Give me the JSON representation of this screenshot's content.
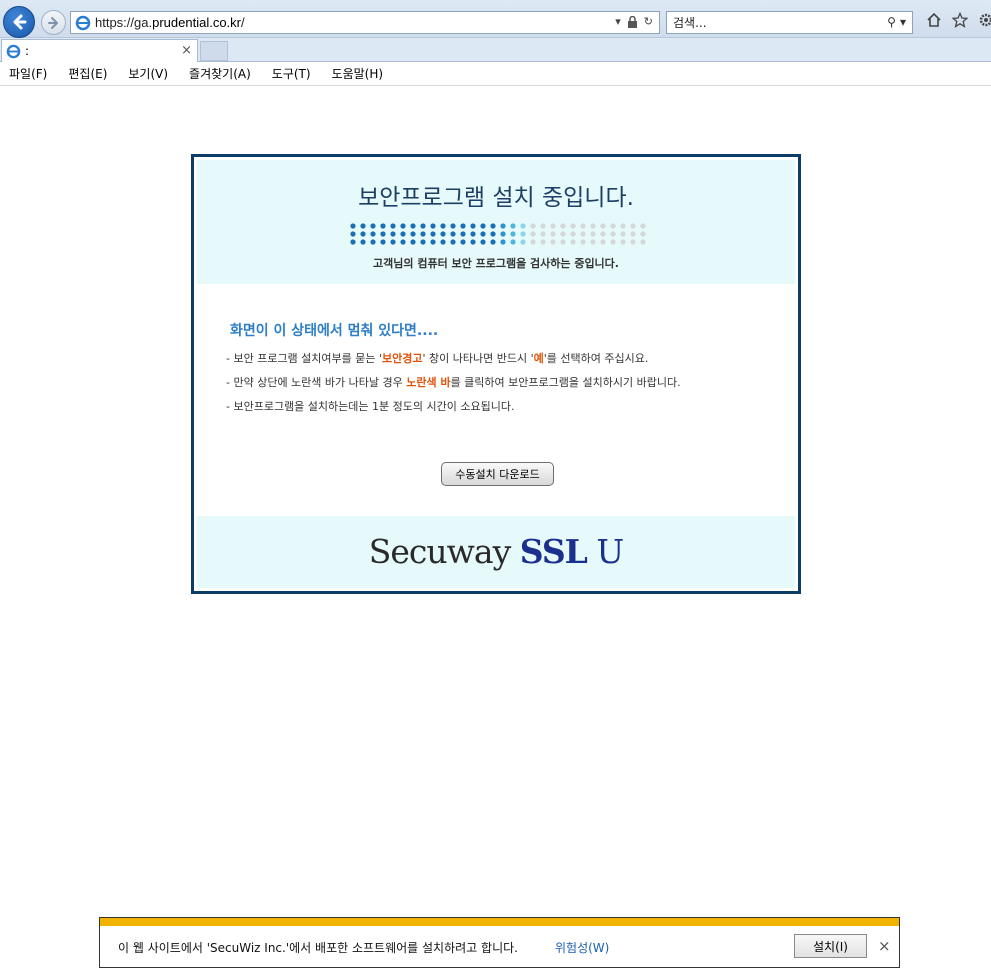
{
  "browser": {
    "address": {
      "scheme": "https://",
      "host_prefix": "ga.",
      "domain": "prudential.co.kr",
      "path": "/"
    },
    "search_placeholder": "검색...",
    "tab_title": ":",
    "menu": [
      "파일(F)",
      "편집(E)",
      "보기(V)",
      "즐겨찾기(A)",
      "도구(T)",
      "도움말(H)"
    ]
  },
  "panel": {
    "title": "보안프로그램 설치 중입니다.",
    "subtitle": "고객님의 컴퓨터 보안 프로그램을 검사하는 중입니다.",
    "progress_fraction": 0.6,
    "body_heading": "화면이 이 상태에서 멈춰 있다면....",
    "line1": {
      "pre": "- 보안 프로그램 설치여부를 묻는 '",
      "hl1": "보안경고",
      "mid": "' 창이 나타나면 반드시 '",
      "hl2": "예",
      "post": "'를 선택하여 주십시요."
    },
    "line2": {
      "pre": "- 만약 상단에 노란색 바가 나타날 경우 ",
      "hl": "노란색 바",
      "post": "를 클릭하여 보안프로그램을 설치하시기 바랍니다."
    },
    "line3": "- 보안프로그램을 설치하는데는 1분 정도의 시간이 소요됩니다.",
    "manual_button": "수동설치 다운로드",
    "logo": {
      "part1": "Secuway ",
      "part2": "SSL",
      "part3": " U"
    }
  },
  "notification": {
    "message": "이 웹 사이트에서 'SecuWiz Inc.'에서 배포한 소프트웨어를 설치하려고 합니다.",
    "risk_link": "위험성(W)",
    "install_button": "설치(I)",
    "close": "×"
  },
  "colors": {
    "accent_blue": "#2e7fc7",
    "highlight_orange": "#e0540a",
    "panel_border": "#0d3d66",
    "notify_stripe": "#f0b400"
  }
}
